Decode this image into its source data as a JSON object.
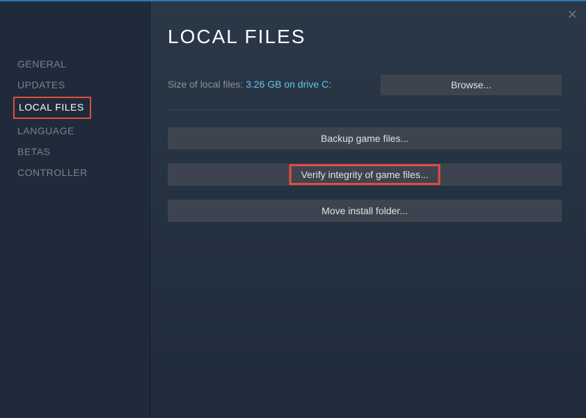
{
  "sidebar": {
    "items": [
      {
        "label": "GENERAL"
      },
      {
        "label": "UPDATES"
      },
      {
        "label": "LOCAL FILES"
      },
      {
        "label": "LANGUAGE"
      },
      {
        "label": "BETAS"
      },
      {
        "label": "CONTROLLER"
      }
    ]
  },
  "main": {
    "title": "LOCAL FILES",
    "size_label": "Size of local files: ",
    "size_value": "3.26 GB on drive C:",
    "browse_label": "Browse...",
    "backup_label": "Backup game files...",
    "verify_label": "Verify integrity of game files...",
    "move_label": "Move install folder..."
  },
  "close_label": "✕"
}
